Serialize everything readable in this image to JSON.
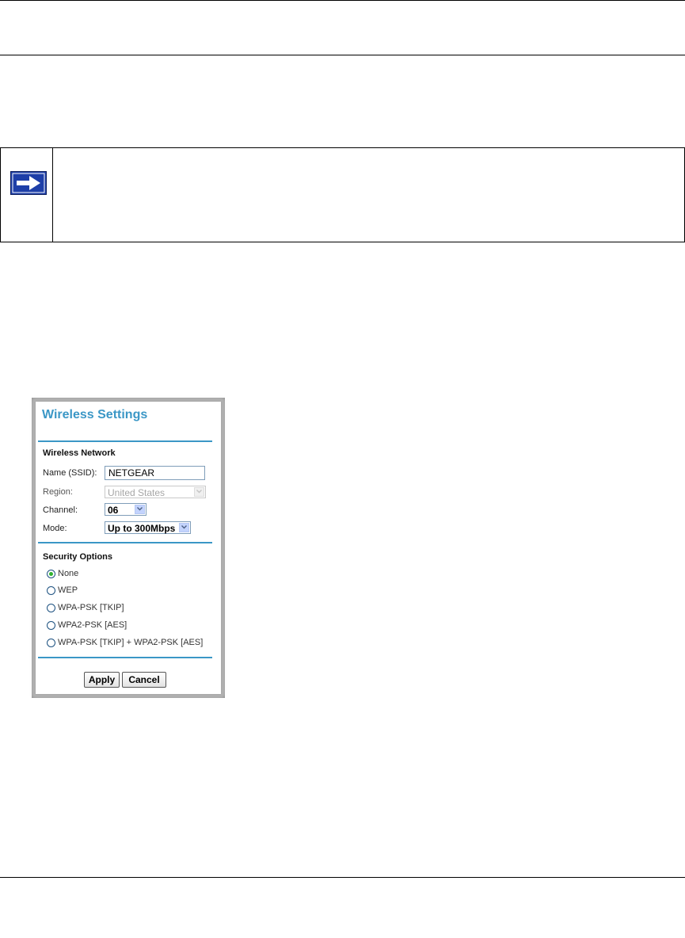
{
  "panel": {
    "title": "Wireless Settings",
    "wireless_network": {
      "heading": "Wireless Network",
      "name_label": "Name (SSID):",
      "name_value": "NETGEAR",
      "region_label": "Region:",
      "region_value": "United States",
      "channel_label": "Channel:",
      "channel_value": "06",
      "mode_label": "Mode:",
      "mode_value": "Up to 300Mbps"
    },
    "security": {
      "heading": "Security Options",
      "options": [
        {
          "label": "None",
          "checked": true
        },
        {
          "label": "WEP",
          "checked": false
        },
        {
          "label": "WPA-PSK [TKIP]",
          "checked": false
        },
        {
          "label": "WPA2-PSK [AES]",
          "checked": false
        },
        {
          "label": "WPA-PSK [TKIP] + WPA2-PSK [AES]",
          "checked": false
        }
      ]
    },
    "buttons": {
      "apply": "Apply",
      "cancel": "Cancel"
    }
  },
  "colors": {
    "accent": "#3b97c6",
    "note_icon_fill": "#1e3fa8",
    "radio_checked": "#2fb22f"
  },
  "icons": {
    "note": "arrow-right-icon"
  }
}
